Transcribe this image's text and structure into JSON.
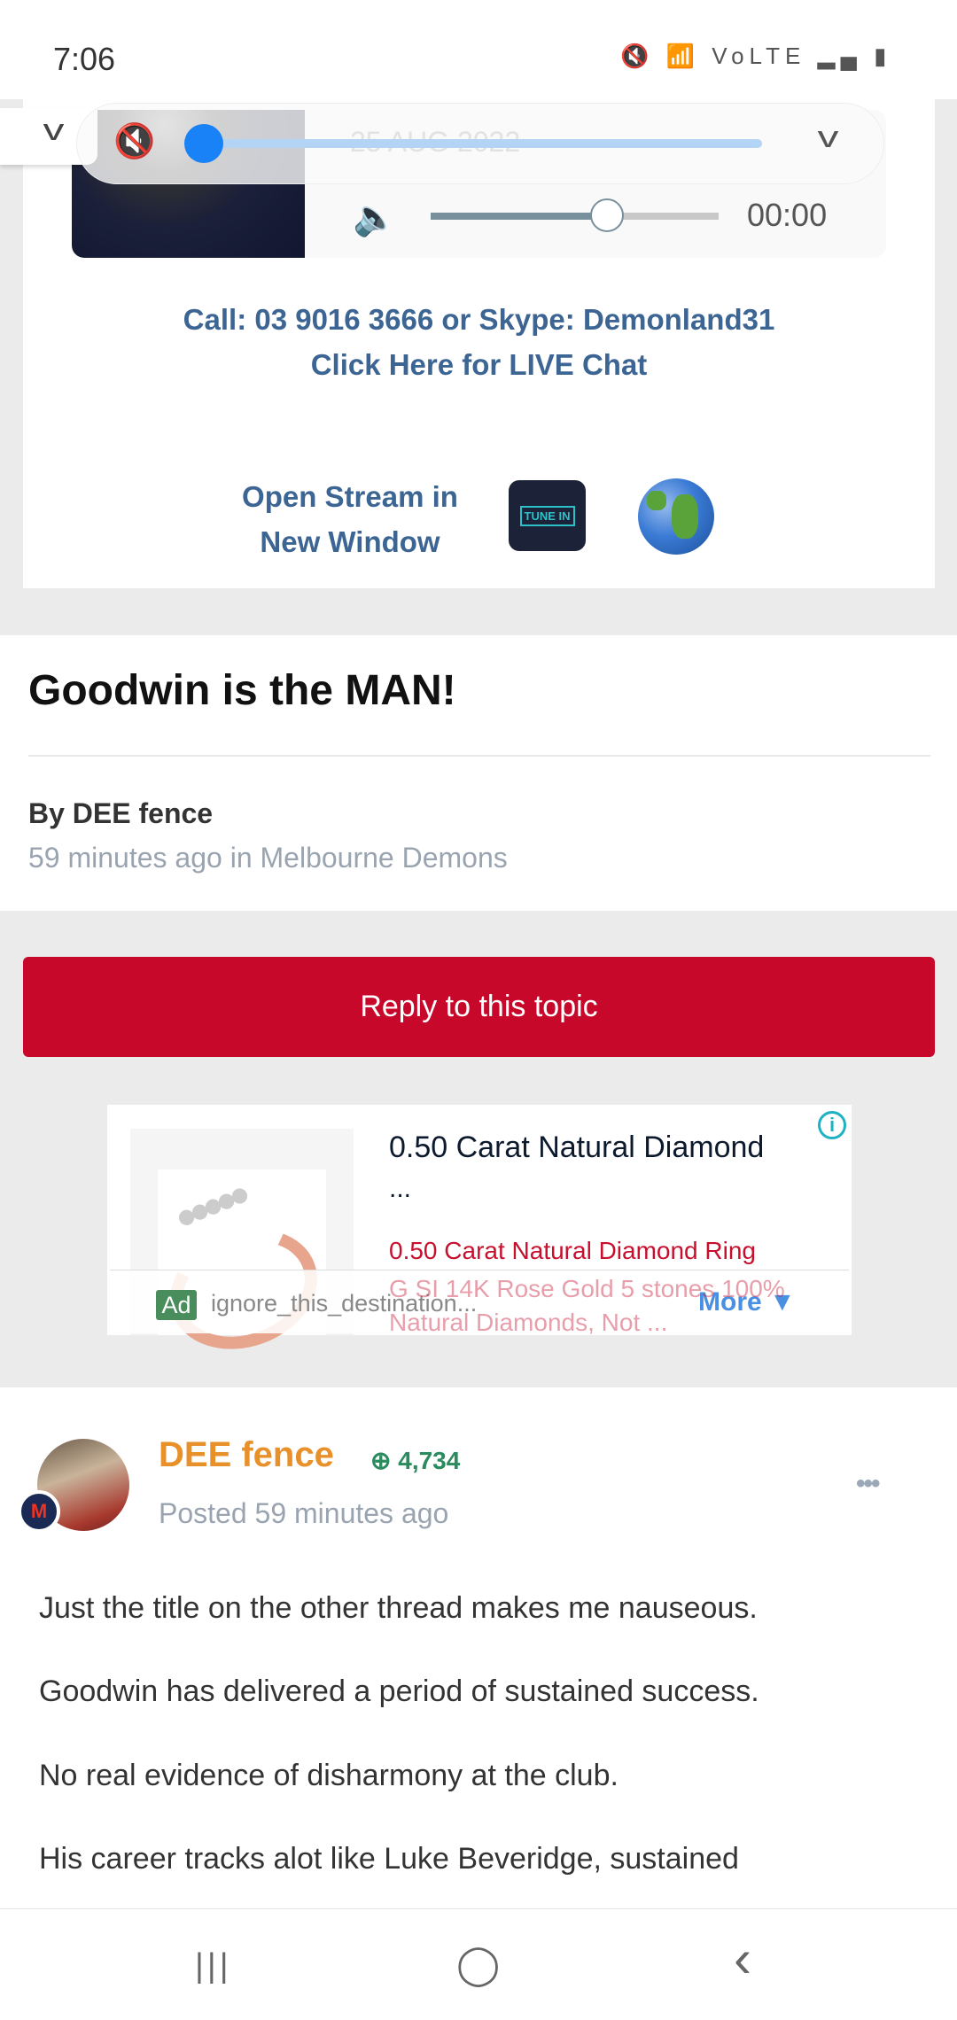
{
  "status_bar": {
    "time": "7:06",
    "icons": "🔇 📶 VoLTE ▂▄ ▮"
  },
  "player": {
    "date": "25 AUG 2022",
    "duration": "00:00",
    "volume_percent": 60,
    "seek_percent": 0,
    "mute_icon": "🔇",
    "volume_icon": "🔈"
  },
  "stream": {
    "call": "Call: 03 9016 3666 or Skype: Demonland31",
    "chat": "Click Here for LIVE Chat",
    "open_stream": "Open Stream in New Window",
    "tunein": "TUNE IN"
  },
  "topic": {
    "title": "Goodwin is the MAN!",
    "author": "By DEE fence",
    "meta": "59 minutes ago in Melbourne Demons"
  },
  "reply_button": "Reply to this topic",
  "ad": {
    "title": "0.50 Carat Natural Diamond",
    "ellipsis": "...",
    "description": "0.50 Carat Natural Diamond Ring",
    "description_faded": "G SI 14K Rose Gold 5 stones 100% Natural Diamonds, Not ...",
    "badge": "Ad",
    "destination": "ignore_this_destination...",
    "more": "More ▼",
    "info": "i"
  },
  "post": {
    "username": "DEE fence",
    "reputation": "4,734",
    "posted": "Posted 59 minutes ago",
    "menu": "•••",
    "paragraphs": [
      "Just the title on the other thread makes me nauseous.",
      "Goodwin has delivered a period of sustained success.",
      "No real evidence of disharmony at the club.",
      "His career tracks alot like Luke Beveridge, sustained"
    ]
  },
  "nav": {
    "recents": "|||",
    "home": "◯",
    "back": "‹"
  }
}
